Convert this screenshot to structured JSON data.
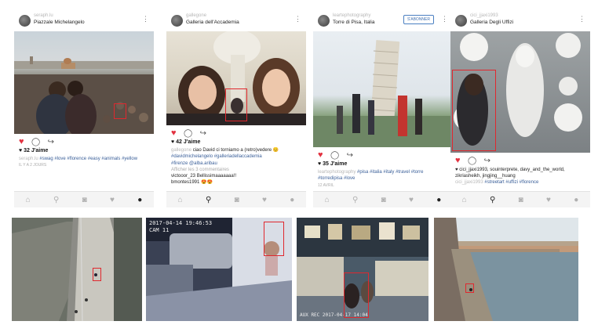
{
  "posts": [
    {
      "username": "seraph.lu",
      "location": "Piazzale Michelangelo",
      "likes": "32 J'aime",
      "caption_user": "seraph.lu",
      "tags": "#swag #love #florence #easy #animals #yellow",
      "time": "IL Y A 2 JOURS"
    },
    {
      "username": "gallegone",
      "location": "Galleria dell'Accademia",
      "likes": "42 J'aime",
      "caption_user": "gallegone",
      "caption_text": "ciao David ci torniamo a (retro)vedere 😊",
      "line2": "#davidmichelangelo #galleriadellaccademia",
      "line3": "#firenze @alba.aribau",
      "view_comments": "Afficher les 3 commentaires",
      "comment1_user": "victooor_23",
      "comment1_text": "Bellissimaaaaaaa!!",
      "comment2_user": "bmontes1991",
      "comment2_text": "😍😍"
    },
    {
      "username": "leartephotography",
      "location": "Torre di Pisa, Italia",
      "follow_label": "S'ABONNER",
      "likes": "35 J'aime",
      "caption_user": "leartephotography",
      "tags": "#pisa #italia #italy #travel #torre #torredipisa #love",
      "time": "12 AVRIL"
    },
    {
      "username": "cici_jjaxi1993",
      "location": "Galleria Degli Uffizi",
      "caption_users": "cici_jjaxi1993, souinterprete, davy_and_the_world, zikriasheikh, jingjing__huang",
      "caption_user2": "cici_jjaxi1993",
      "tags": "#streetart #uffizi #florence"
    }
  ],
  "nav_icons": [
    "home-icon",
    "search-icon",
    "camera-icon",
    "heart-icon",
    "profile-icon"
  ],
  "cctv": [
    {
      "stamp": ""
    },
    {
      "stamp": "2017-04-14  19:46:53",
      "cam": "CAM 11"
    },
    {
      "stamp": "AUX REC   2017-04-17  14:04",
      "cam": ""
    },
    {
      "stamp": ""
    }
  ],
  "colors": {
    "highlight": "#e0282e",
    "heart": "#e23240",
    "hashtag": "#3a5f99"
  }
}
